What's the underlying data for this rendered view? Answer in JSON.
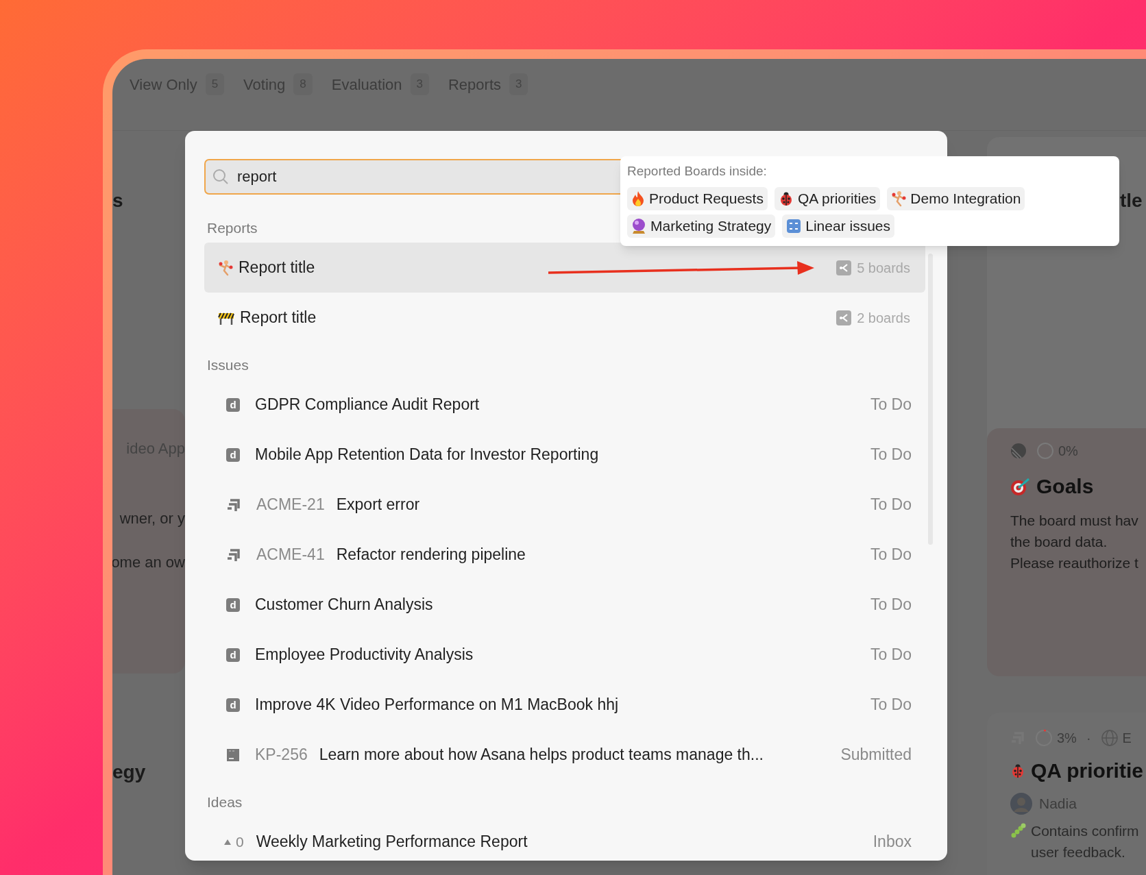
{
  "tabs": [
    {
      "label": "View Only",
      "count": "5"
    },
    {
      "label": "Voting",
      "count": "8"
    },
    {
      "label": "Evaluation",
      "count": "3"
    },
    {
      "label": "Reports",
      "count": "3"
    }
  ],
  "background": {
    "left": {
      "heading": "s",
      "card_lines": [
        "ideo App",
        "wner, or y",
        "ome an ow"
      ],
      "bottom_heading": "egy"
    },
    "right": {
      "heading": "tle",
      "goals_card": {
        "progress": "0%",
        "title": "Goals",
        "text": "The board must hav\nthe board data.\nPlease reauthorize t"
      },
      "qa_card": {
        "progress": "3%",
        "separator": "·",
        "tag": "E",
        "title": "QA prioritie",
        "owner": "Nadia",
        "text": "Contains confirm\nuser feedback."
      }
    }
  },
  "search": {
    "value": "report"
  },
  "popover": {
    "title": "Reported Boards inside:",
    "boards": [
      {
        "label": "Product Requests"
      },
      {
        "label": "QA priorities"
      },
      {
        "label": "Demo Integration"
      },
      {
        "label": "Marketing Strategy"
      },
      {
        "label": "Linear issues"
      }
    ]
  },
  "sections": [
    {
      "title": "Reports",
      "items": [
        {
          "kind": "report",
          "title": "Report title",
          "boards": "5 boards",
          "selected": true
        },
        {
          "kind": "report",
          "title": "Report title",
          "boards": "2 boards",
          "selected": false
        }
      ]
    },
    {
      "title": "Issues",
      "items": [
        {
          "kind": "badge",
          "letter": "d",
          "title": "GDPR Compliance Audit Report",
          "status": "To Do",
          "selected": false
        },
        {
          "kind": "badge",
          "letter": "d",
          "title": "Mobile App Retention Data for Investor Reporting",
          "status": "To Do",
          "selected": false
        },
        {
          "kind": "chevron",
          "key": "ACME-21",
          "title": "Export error",
          "status": "To Do",
          "selected": false
        },
        {
          "kind": "chevron",
          "key": "ACME-41",
          "title": "Refactor rendering pipeline",
          "status": "To Do",
          "selected": false
        },
        {
          "kind": "badge",
          "letter": "d",
          "title": "Customer Churn Analysis",
          "status": "To Do",
          "selected": false
        },
        {
          "kind": "badge",
          "letter": "d",
          "title": "Employee Productivity Analysis",
          "status": "To Do",
          "selected": false
        },
        {
          "kind": "badge",
          "letter": "d",
          "title": "Improve 4K Video Performance on M1 MacBook hhj",
          "status": "To Do",
          "selected": false
        },
        {
          "kind": "square",
          "key": "KP-256",
          "title": "Learn more about how Asana helps product teams manage th...",
          "status": "Submitted",
          "selected": false
        }
      ]
    },
    {
      "title": "Ideas",
      "items": [
        {
          "kind": "idea",
          "votes": "0",
          "title": "Weekly Marketing Performance Report",
          "status": "Inbox",
          "selected": false
        }
      ]
    }
  ]
}
